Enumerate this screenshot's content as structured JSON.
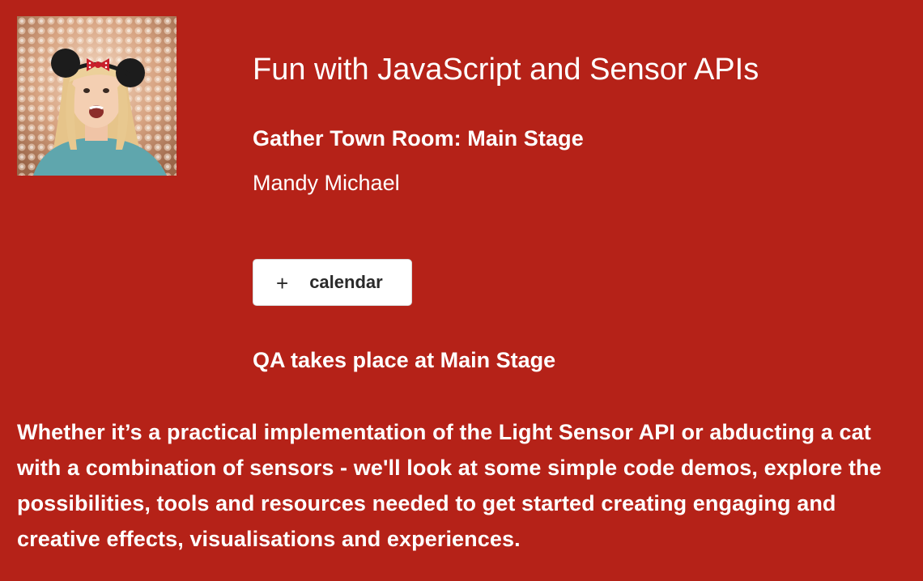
{
  "session": {
    "title": "Fun with JavaScript and Sensor APIs",
    "room": "Gather Town Room: Main Stage",
    "speaker": "Mandy Michael",
    "calendar_button": {
      "icon": "plus-icon",
      "icon_glyph": "+",
      "label": "calendar"
    },
    "qa_note": "QA takes place at Main Stage",
    "description": "Whether it’s a practical implementation of the Light Sensor API or abducting a cat with a combination of sensors - we'll look at some simple code demos, explore the possibilities, tools and resources needed to get started creating engaging and creative effects, visualisations and experiences."
  },
  "colors": {
    "background": "#b52218",
    "text": "#ffffff",
    "button_background": "#ffffff",
    "button_text": "#2a2a2a"
  }
}
